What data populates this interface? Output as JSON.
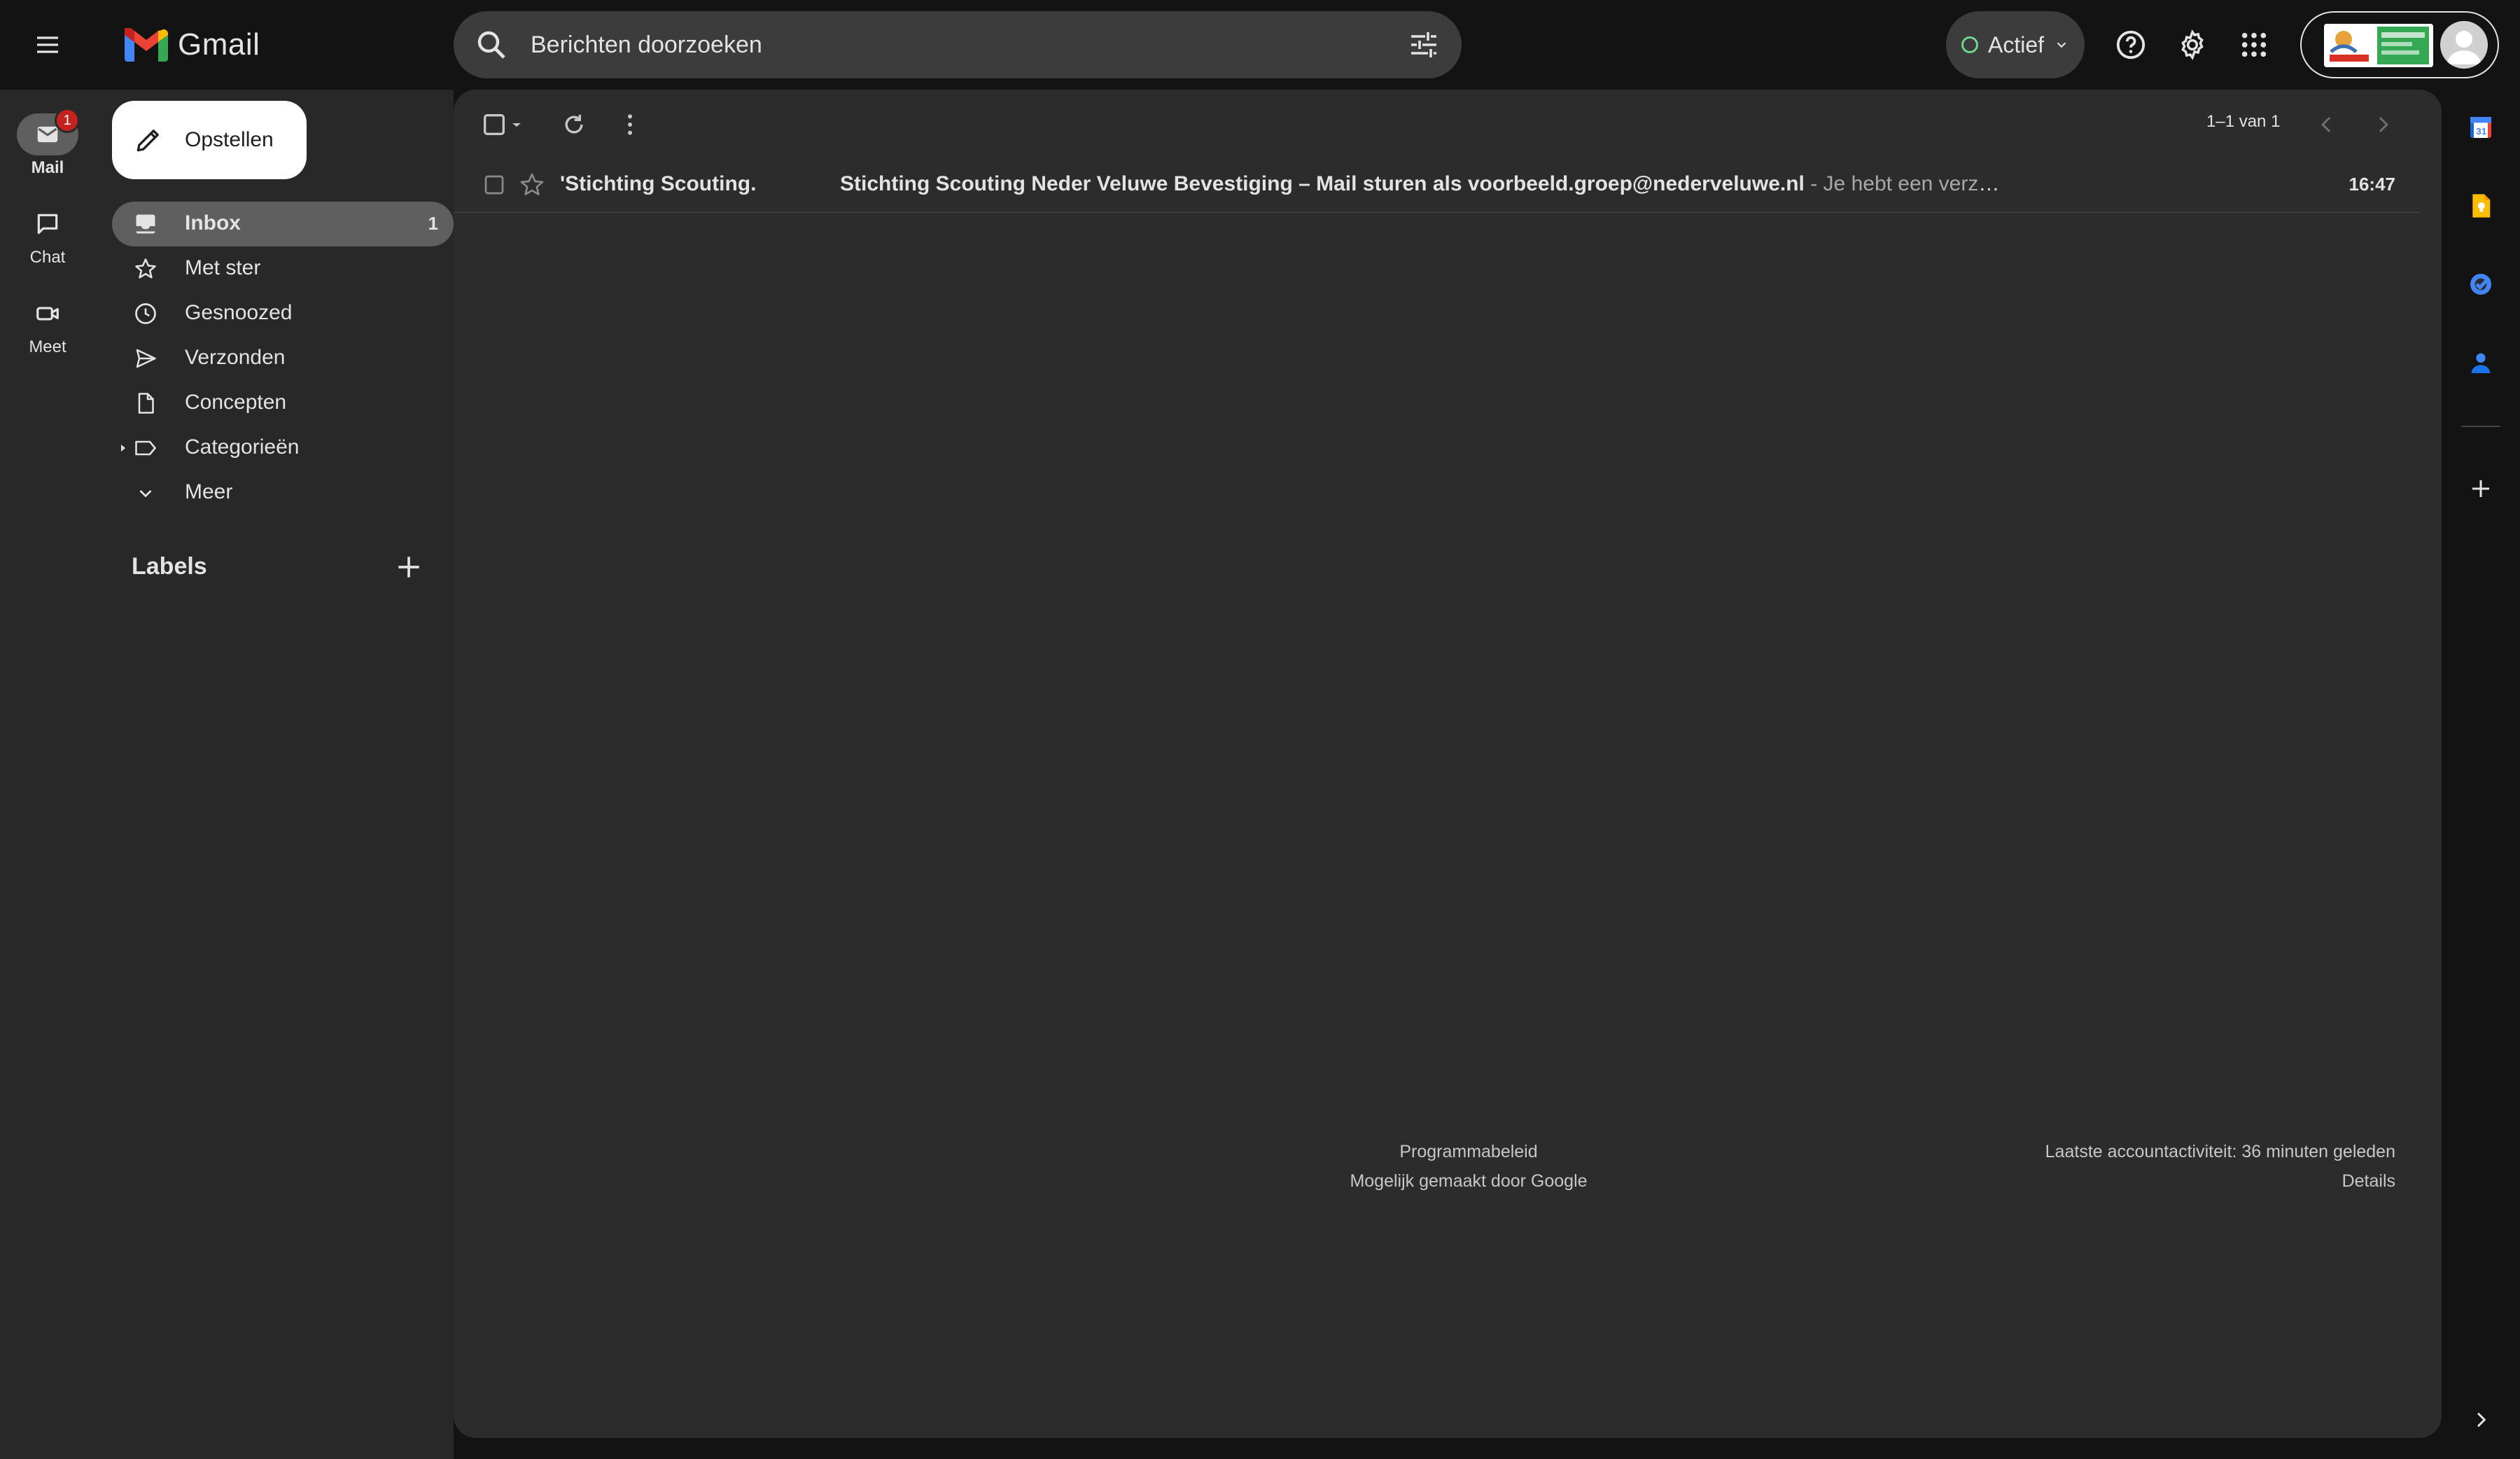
{
  "app": {
    "name": "Gmail"
  },
  "search": {
    "placeholder": "Berichten doorzoeken"
  },
  "status": {
    "label": "Actief",
    "color": "#6dd58c"
  },
  "rail": {
    "items": [
      {
        "label": "Mail",
        "icon": "mail-icon",
        "badge": "1",
        "active": true
      },
      {
        "label": "Chat",
        "icon": "chat-icon"
      },
      {
        "label": "Meet",
        "icon": "video-icon"
      }
    ]
  },
  "compose": {
    "label": "Opstellen"
  },
  "nav": {
    "items": [
      {
        "label": "Inbox",
        "icon": "inbox-icon",
        "count": "1",
        "active": true
      },
      {
        "label": "Met ster",
        "icon": "star-icon"
      },
      {
        "label": "Gesnoozed",
        "icon": "clock-icon"
      },
      {
        "label": "Verzonden",
        "icon": "send-icon"
      },
      {
        "label": "Concepten",
        "icon": "draft-icon"
      },
      {
        "label": "Categorieën",
        "icon": "label-icon"
      },
      {
        "label": "Meer",
        "icon": "chevron-down-icon"
      }
    ],
    "labels_heading": "Labels"
  },
  "toolbar": {
    "pager_text": "1–1 van 1"
  },
  "messages": [
    {
      "sender": "'Stichting Scouting.",
      "subject": "Stichting Scouting Neder Veluwe Bevestiging – Mail sturen als voorbeeld.groep@nederveluwe.nl",
      "snippet": " - Je hebt een verzoek ingediend om voorbeeld.groep...",
      "time": "16:47",
      "unread": true
    }
  ],
  "footer": {
    "policy": "Programmabeleid",
    "powered": "Mogelijk gemaakt door Google",
    "activity": "Laatste accountactiviteit: 36 minuten geleden",
    "details": "Details"
  },
  "colors": {
    "background": "#131314",
    "panel": "#2c2c2c",
    "sidebar": "#282828",
    "active_item": "#5f5f5f",
    "badge": "#c5221f"
  }
}
